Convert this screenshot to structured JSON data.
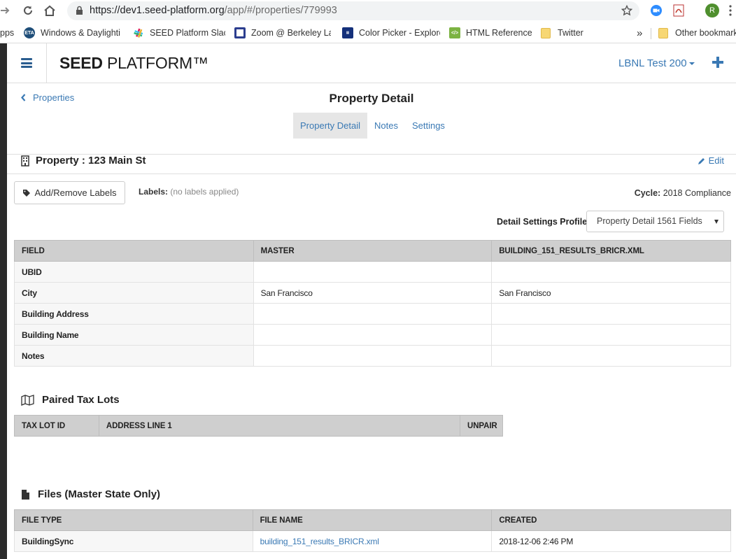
{
  "browser": {
    "url_host": "https://dev1.seed-platform.org",
    "url_path": "/app/#/properties/779993",
    "profile_initial": "R",
    "bookmarks": [
      {
        "label": "pps"
      },
      {
        "label": "Windows & Daylighti",
        "icon": "ETA"
      },
      {
        "label": "SEED Platform Slack"
      },
      {
        "label": "Zoom @ Berkeley Lal"
      },
      {
        "label": "Color Picker - Explore"
      },
      {
        "label": "HTML Reference"
      },
      {
        "label": "Twitter"
      }
    ],
    "more_bookmarks": "»",
    "other_bookmarks": "Other bookmarks"
  },
  "app": {
    "brand_bold": "SEED",
    "brand_rest": " PLATFORM™",
    "org_name": "LBNL Test 200"
  },
  "page": {
    "back_label": "Properties",
    "title": "Property Detail",
    "tabs": [
      "Property Detail",
      "Notes",
      "Settings"
    ]
  },
  "property": {
    "title": "Property : 123 Main St",
    "edit_label": "Edit",
    "labels_button": "Add/Remove Labels",
    "labels_caption": "Labels:",
    "labels_value": "(no labels applied)",
    "cycle_caption": "Cycle:",
    "cycle_value": "2018 Compliance",
    "profile_caption": "Detail Settings Profile:",
    "profile_value": "Property Detail 1561 Fields"
  },
  "detail_table": {
    "headers": [
      "FIELD",
      "MASTER",
      "BUILDING_151_RESULTS_BRICR.XML"
    ],
    "rows": [
      [
        "UBID",
        "",
        ""
      ],
      [
        "City",
        "San Francisco",
        "San Francisco"
      ],
      [
        "Building Address",
        "",
        ""
      ],
      [
        "Building Name",
        "",
        ""
      ],
      [
        "Notes",
        "",
        ""
      ]
    ]
  },
  "tax_lots": {
    "title": "Paired Tax Lots",
    "headers": [
      "TAX LOT ID",
      "ADDRESS LINE 1",
      "UNPAIR"
    ]
  },
  "files": {
    "title": "Files (Master State Only)",
    "headers": [
      "FILE TYPE",
      "FILE NAME",
      "CREATED"
    ],
    "rows": [
      [
        "BuildingSync",
        "building_151_results_BRICR.xml",
        "2018-12-06 2:46 PM"
      ]
    ]
  }
}
